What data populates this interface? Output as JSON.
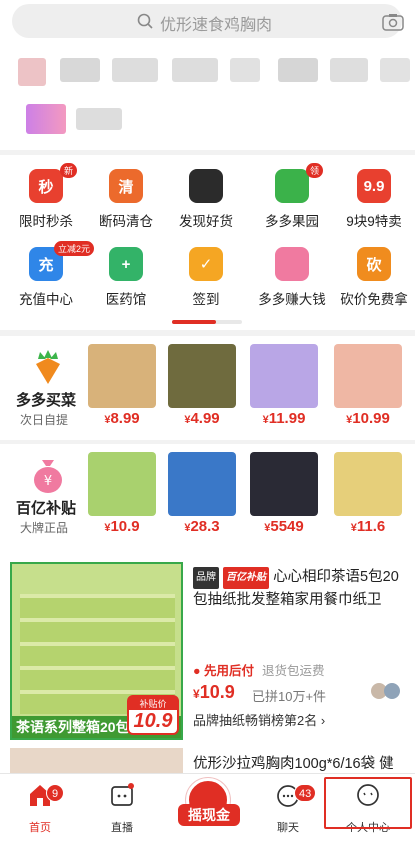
{
  "search": {
    "placeholder": "优形速食鸡胸肉"
  },
  "categories": [
    {
      "label": "限时秒杀",
      "icon": "flash-sale-icon",
      "tag": "新",
      "color": "#e8402f",
      "glyph": "秒"
    },
    {
      "label": "断码清仓",
      "icon": "truck-icon",
      "tag": "",
      "color": "#ec6a2c",
      "glyph": "清"
    },
    {
      "label": "发现好货",
      "icon": "diamond-icon",
      "tag": "",
      "color": "#2b2b2b",
      "glyph": ""
    },
    {
      "label": "多多果园",
      "icon": "tree-icon",
      "tag": "领",
      "color": "#3bb24a",
      "glyph": ""
    },
    {
      "label": "9块9特卖",
      "icon": "ninenine-icon",
      "tag": "",
      "color": "#e8402f",
      "glyph": "9.9"
    },
    {
      "label": "充值中心",
      "icon": "recharge-icon",
      "tag": "立减2元",
      "color": "#2f86e8",
      "glyph": "充"
    },
    {
      "label": "医药馆",
      "icon": "medical-kit-icon",
      "tag": "",
      "color": "#33b368",
      "glyph": "+"
    },
    {
      "label": "签到",
      "icon": "calendar-check-icon",
      "tag": "",
      "color": "#f5a623",
      "glyph": "✓"
    },
    {
      "label": "多多赚大钱",
      "icon": "piggy-bank-icon",
      "tag": "",
      "color": "#f07aa0",
      "glyph": ""
    },
    {
      "label": "砍价免费拿",
      "icon": "bargain-icon",
      "tag": "",
      "color": "#f08c1e",
      "glyph": "砍"
    }
  ],
  "promo1": {
    "title": "多多买菜",
    "subtitle": "次日自提",
    "items": [
      {
        "price": "8.99",
        "color": "#d8b27a"
      },
      {
        "price": "4.99",
        "color": "#6f6b3e"
      },
      {
        "price": "11.99",
        "color": "#b9a6e6"
      },
      {
        "price": "10.99",
        "color": "#efb7a4"
      }
    ]
  },
  "promo2": {
    "title": "百亿补贴",
    "subtitle": "大牌正品",
    "items": [
      {
        "price": "10.9",
        "color": "#a9d16e"
      },
      {
        "price": "28.3",
        "color": "#3a78c8"
      },
      {
        "price": "5549",
        "color": "#2a2a35"
      },
      {
        "price": "11.6",
        "color": "#e6cf7a"
      }
    ]
  },
  "feed": {
    "image_banner": "茶语系列整箱20包",
    "image_price_label": "补贴价",
    "image_price": "10.9",
    "badge_brand": "品牌",
    "badge_subsidy": "百亿补贴",
    "title": "心心相印茶语5包20包抽纸批发整箱家用餐巾纸卫",
    "pay_later": "先用后付",
    "return_fee": "退货包运费",
    "price": "10.9",
    "sold": "已拼10万+件",
    "rank": "品牌抽纸畅销榜第2名 ›"
  },
  "next_item": {
    "title": "优形沙拉鸡胸肉100g*6/16袋 健"
  },
  "price_symbol": "¥",
  "tabbar": {
    "home": "首页",
    "home_count": "9",
    "live": "直播",
    "shake": "摇现金",
    "chat": "聊天",
    "chat_count": "43",
    "profile": "个人中心"
  }
}
